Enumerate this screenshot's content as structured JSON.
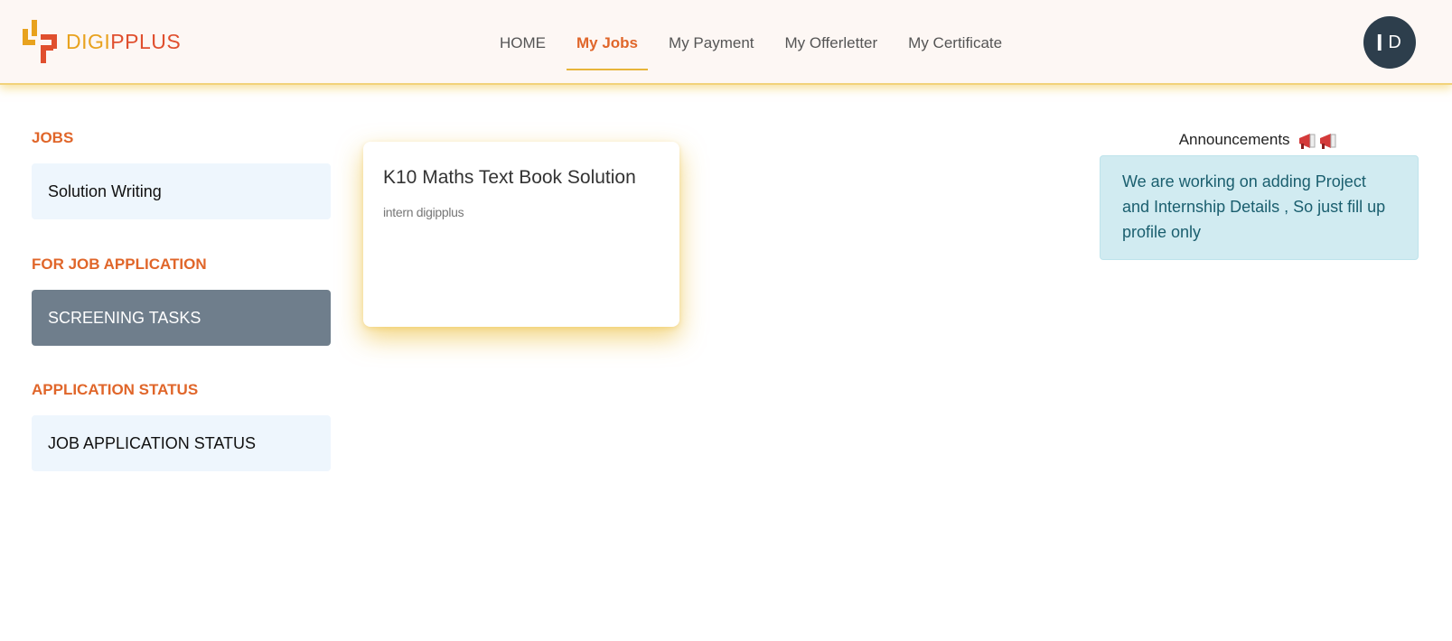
{
  "brand": {
    "part1": "DIGI",
    "part2": "PPLUS",
    "color1": "#e8a21e",
    "color2": "#e04f2e"
  },
  "nav": [
    {
      "label": "HOME",
      "active": false
    },
    {
      "label": "My Jobs",
      "active": true
    },
    {
      "label": "My Payment",
      "active": false
    },
    {
      "label": "My Offerletter",
      "active": false
    },
    {
      "label": "My Certificate",
      "active": false
    }
  ],
  "avatar": {
    "initial1": "I",
    "initial2": "D"
  },
  "sidebar": {
    "jobs_title": "JOBS",
    "jobs_item": "Solution Writing",
    "application_title": "FOR JOB APPLICATION",
    "application_item": "SCREENING TASKS",
    "status_title": "APPLICATION STATUS",
    "status_item": "JOB APPLICATION STATUS"
  },
  "job_card": {
    "title": "K10 Maths Text Book Solution",
    "subtitle": "intern digipplus"
  },
  "announcements": {
    "title": "Announcements",
    "icon": "megaphone-icon",
    "message": "We are working on adding Project and Internship Details , So just fill up profile only"
  },
  "colors": {
    "accent": "#e0662a",
    "underline": "#e8b53a",
    "avatar_bg": "#2d3e4c",
    "alert_bg": "#d1ebf1"
  }
}
